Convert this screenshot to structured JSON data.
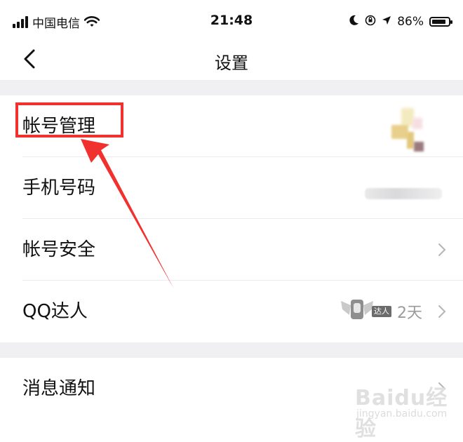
{
  "status_bar": {
    "carrier": "中国电信",
    "time": "21:48",
    "battery": "86%",
    "battery_level": 0.86
  },
  "nav": {
    "title": "设置",
    "back_icon": "chevron-left-icon"
  },
  "settings": {
    "account_management": "帐号管理",
    "phone_number": "手机号码",
    "account_security": "帐号安全",
    "qq_expert": "QQ达人",
    "qq_expert_badge": "达人",
    "qq_expert_days": "2天",
    "notifications": "消息通知"
  },
  "annotation": {
    "highlight_color": "#f0312e"
  },
  "watermark": {
    "logo": "Baidu经验",
    "url": "jingyan.baidu.com"
  }
}
